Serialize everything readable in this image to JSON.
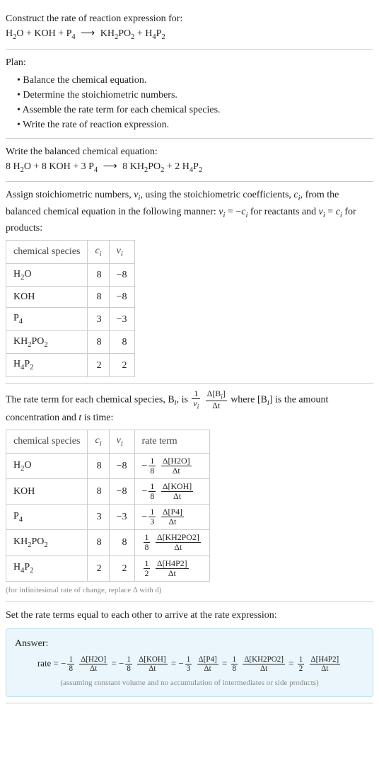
{
  "prompt": {
    "line1": "Construct the rate of reaction expression for:",
    "eq_lhs1": "H",
    "eq_sub1": "2",
    "eq_lhs2": "O + KOH + P",
    "eq_sub2": "4",
    "arrow": "⟶",
    "eq_rhs1": "KH",
    "eq_rsub1": "2",
    "eq_rhs2": "PO",
    "eq_rsub2": "2",
    "eq_rhs3": " + H",
    "eq_rsub3": "4",
    "eq_rhs4": "P",
    "eq_rsub4": "2"
  },
  "plan": {
    "heading": "Plan:",
    "items": [
      "Balance the chemical equation.",
      "Determine the stoichiometric numbers.",
      "Assemble the rate term for each chemical species.",
      "Write the rate of reaction expression."
    ]
  },
  "balanced": {
    "intro": "Write the balanced chemical equation:",
    "c1": "8 H",
    "s1": "2",
    "c2": "O + 8 KOH + 3 P",
    "s2": "4",
    "arrow": "⟶",
    "c3": " 8 KH",
    "s3": "2",
    "c4": "PO",
    "s4": "2",
    "c5": " + 2 H",
    "s5": "4",
    "c6": "P",
    "s6": "2"
  },
  "assign": {
    "text1": "Assign stoichiometric numbers, ",
    "nu": "ν",
    "sub_i": "i",
    "text2": ", using the stoichiometric coefficients, ",
    "c": "c",
    "text3": ", from the balanced chemical equation in the following manner: ",
    "eq1": "ν",
    "eq1sub": "i",
    "eq1mid": " = −",
    "eq1c": "c",
    "eq1csub": "i",
    "text4": " for reactants and ",
    "eq2": "ν",
    "eq2sub": "i",
    "eq2mid": " = ",
    "eq2c": "c",
    "eq2csub": "i",
    "text5": " for products:"
  },
  "table1": {
    "headers": {
      "h1": "chemical species",
      "h2": "c",
      "h2sub": "i",
      "h3": "ν",
      "h3sub": "i"
    },
    "rows": [
      {
        "sp1": "H",
        "spsub1": "2",
        "sp2": "O",
        "c": "8",
        "nu": "−8"
      },
      {
        "sp1": "KOH",
        "spsub1": "",
        "sp2": "",
        "c": "8",
        "nu": "−8"
      },
      {
        "sp1": "P",
        "spsub1": "4",
        "sp2": "",
        "c": "3",
        "nu": "−3"
      },
      {
        "sp1": "KH",
        "spsub1": "2",
        "sp2": "PO",
        "spsub2": "2",
        "c": "8",
        "nu": "8"
      },
      {
        "sp1": "H",
        "spsub1": "4",
        "sp2": "P",
        "spsub2": "2",
        "c": "2",
        "nu": "2"
      }
    ]
  },
  "rateterm_intro": {
    "t1": "The rate term for each chemical species, B",
    "sub1": "i",
    "t2": ", is ",
    "frac1num": "1",
    "frac1den_a": "ν",
    "frac1den_sub": "i",
    "frac2num_a": "Δ[B",
    "frac2num_sub": "i",
    "frac2num_b": "]",
    "frac2den": "Δt",
    "t3": " where [B",
    "t3sub": "i",
    "t4": "] is the amount concentration and ",
    "t5": "t",
    "t6": " is time:"
  },
  "table2": {
    "headers": {
      "h1": "chemical species",
      "h2": "c",
      "h2sub": "i",
      "h3": "ν",
      "h3sub": "i",
      "h4": "rate term"
    },
    "rows": [
      {
        "sp1": "H",
        "spsub1": "2",
        "sp2": "O",
        "c": "8",
        "nu": "−8",
        "sign": "−",
        "fn": "1",
        "fd": "8",
        "dn": "Δ[H2O]",
        "dd": "Δt"
      },
      {
        "sp1": "KOH",
        "spsub1": "",
        "sp2": "",
        "c": "8",
        "nu": "−8",
        "sign": "−",
        "fn": "1",
        "fd": "8",
        "dn": "Δ[KOH]",
        "dd": "Δt"
      },
      {
        "sp1": "P",
        "spsub1": "4",
        "sp2": "",
        "c": "3",
        "nu": "−3",
        "sign": "−",
        "fn": "1",
        "fd": "3",
        "dn": "Δ[P4]",
        "dd": "Δt"
      },
      {
        "sp1": "KH",
        "spsub1": "2",
        "sp2": "PO",
        "spsub2": "2",
        "c": "8",
        "nu": "8",
        "sign": "",
        "fn": "1",
        "fd": "8",
        "dn": "Δ[KH2PO2]",
        "dd": "Δt"
      },
      {
        "sp1": "H",
        "spsub1": "4",
        "sp2": "P",
        "spsub2": "2",
        "c": "2",
        "nu": "2",
        "sign": "",
        "fn": "1",
        "fd": "2",
        "dn": "Δ[H4P2]",
        "dd": "Δt"
      }
    ],
    "note": "(for infinitesimal rate of change, replace Δ with d)"
  },
  "setequal": "Set the rate terms equal to each other to arrive at the rate expression:",
  "answer": {
    "label": "Answer:",
    "lhs": "rate = ",
    "terms": [
      {
        "sign": "−",
        "fn": "1",
        "fd": "8",
        "dn": "Δ[H2O]",
        "dd": "Δt",
        "sep": " = "
      },
      {
        "sign": "−",
        "fn": "1",
        "fd": "8",
        "dn": "Δ[KOH]",
        "dd": "Δt",
        "sep": " = "
      },
      {
        "sign": "−",
        "fn": "1",
        "fd": "3",
        "dn": "Δ[P4]",
        "dd": "Δt",
        "sep": " = "
      },
      {
        "sign": "",
        "fn": "1",
        "fd": "8",
        "dn": "Δ[KH2PO2]",
        "dd": "Δt",
        "sep": " = "
      },
      {
        "sign": "",
        "fn": "1",
        "fd": "2",
        "dn": "Δ[H4P2]",
        "dd": "Δt",
        "sep": ""
      }
    ],
    "note": "(assuming constant volume and no accumulation of intermediates or side products)"
  }
}
